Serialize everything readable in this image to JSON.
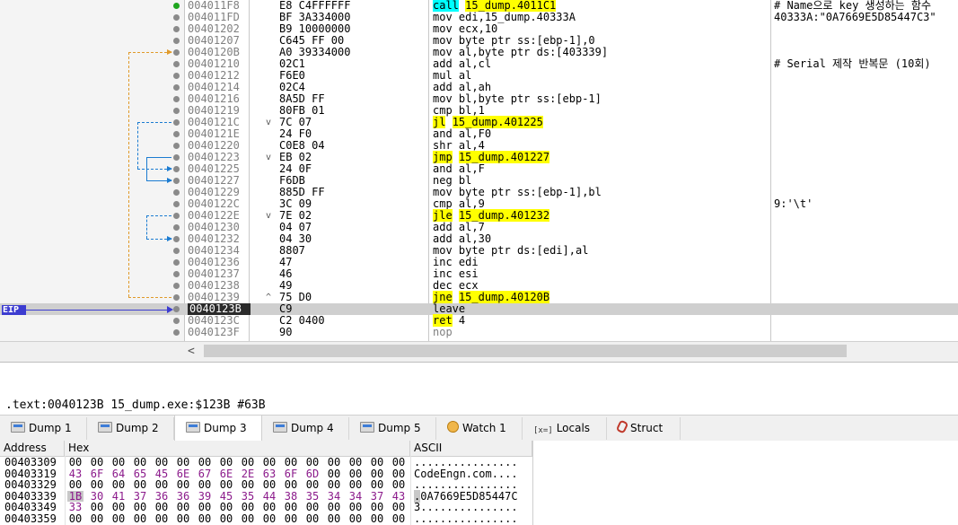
{
  "disassembly": {
    "rows": [
      {
        "addr": "004011F8",
        "bytes": "E8 C4FFFFFF",
        "mnem": "call",
        "ops": "15_dump.4011C1",
        "mnem_hl": "cyan",
        "ops_hl": "yellow",
        "jmark": "",
        "comment": "# Name으로 key 생성하는 함수",
        "dot": "green"
      },
      {
        "addr": "004011FD",
        "bytes": "BF 3A334000",
        "mnem": "mov",
        "ops": "edi,15_dump.40333A",
        "jmark": "",
        "comment": "40333A:\"0A7669E5D85447C3\""
      },
      {
        "addr": "00401202",
        "bytes": "B9 10000000",
        "mnem": "mov",
        "ops": "ecx,10",
        "jmark": "",
        "comment": ""
      },
      {
        "addr": "00401207",
        "bytes": "C645 FF 00",
        "mnem": "mov",
        "ops": "byte ptr ss:[ebp-1],0",
        "jmark": "",
        "comment": ""
      },
      {
        "addr": "0040120B",
        "bytes": "A0 39334000",
        "mnem": "mov",
        "ops": "al,byte ptr ds:[403339]",
        "jmark": "",
        "comment": ""
      },
      {
        "addr": "00401210",
        "bytes": "02C1",
        "mnem": "add",
        "ops": "al,cl",
        "jmark": "",
        "comment": "# Serial 제작 반복문 (10회)"
      },
      {
        "addr": "00401212",
        "bytes": "F6E0",
        "mnem": "mul",
        "ops": "al",
        "jmark": "",
        "comment": ""
      },
      {
        "addr": "00401214",
        "bytes": "02C4",
        "mnem": "add",
        "ops": "al,ah",
        "jmark": "",
        "comment": ""
      },
      {
        "addr": "00401216",
        "bytes": "8A5D FF",
        "mnem": "mov",
        "ops": "bl,byte ptr ss:[ebp-1]",
        "jmark": "",
        "comment": ""
      },
      {
        "addr": "00401219",
        "bytes": "80FB 01",
        "mnem": "cmp",
        "ops": "bl,1",
        "jmark": "",
        "comment": ""
      },
      {
        "addr": "0040121C",
        "bytes": "7C 07",
        "mnem": "jl",
        "ops": "15_dump.401225",
        "mnem_hl": "yellow",
        "ops_hl": "yellow",
        "jmark": "v",
        "comment": ""
      },
      {
        "addr": "0040121E",
        "bytes": "24 F0",
        "mnem": "and",
        "ops": "al,F0",
        "jmark": "",
        "comment": ""
      },
      {
        "addr": "00401220",
        "bytes": "C0E8 04",
        "mnem": "shr",
        "ops": "al,4",
        "jmark": "",
        "comment": ""
      },
      {
        "addr": "00401223",
        "bytes": "EB 02",
        "mnem": "jmp",
        "ops": "15_dump.401227",
        "mnem_hl": "yellow",
        "ops_hl": "yellow",
        "jmark": "v",
        "comment": ""
      },
      {
        "addr": "00401225",
        "bytes": "24 0F",
        "mnem": "and",
        "ops": "al,F",
        "jmark": "",
        "comment": ""
      },
      {
        "addr": "00401227",
        "bytes": "F6DB",
        "mnem": "neg",
        "ops": "bl",
        "jmark": "",
        "comment": ""
      },
      {
        "addr": "00401229",
        "bytes": "885D FF",
        "mnem": "mov",
        "ops": "byte ptr ss:[ebp-1],bl",
        "jmark": "",
        "comment": ""
      },
      {
        "addr": "0040122C",
        "bytes": "3C 09",
        "mnem": "cmp",
        "ops": "al,9",
        "jmark": "",
        "comment": "9:'\\t'"
      },
      {
        "addr": "0040122E",
        "bytes": "7E 02",
        "mnem": "jle",
        "ops": "15_dump.401232",
        "mnem_hl": "yellow",
        "ops_hl": "yellow",
        "jmark": "v",
        "comment": ""
      },
      {
        "addr": "00401230",
        "bytes": "04 07",
        "mnem": "add",
        "ops": "al,7",
        "jmark": "",
        "comment": ""
      },
      {
        "addr": "00401232",
        "bytes": "04 30",
        "mnem": "add",
        "ops": "al,30",
        "jmark": "",
        "comment": ""
      },
      {
        "addr": "00401234",
        "bytes": "8807",
        "mnem": "mov",
        "ops": "byte ptr ds:[edi],al",
        "jmark": "",
        "comment": ""
      },
      {
        "addr": "00401236",
        "bytes": "47",
        "mnem": "inc",
        "ops": "edi",
        "jmark": "",
        "comment": ""
      },
      {
        "addr": "00401237",
        "bytes": "46",
        "mnem": "inc",
        "ops": "esi",
        "jmark": "",
        "comment": ""
      },
      {
        "addr": "00401238",
        "bytes": "49",
        "mnem": "dec",
        "ops": "ecx",
        "jmark": "",
        "comment": ""
      },
      {
        "addr": "00401239",
        "bytes": "75 D0",
        "mnem": "jne",
        "ops": "15_dump.40120B",
        "mnem_hl": "yellow",
        "ops_hl": "yellow",
        "jmark": "^",
        "comment": ""
      },
      {
        "addr": "0040123B",
        "bytes": "C9",
        "mnem": "leave",
        "ops": "",
        "jmark": "",
        "comment": "",
        "current": true
      },
      {
        "addr": "0040123C",
        "bytes": "C2 0400",
        "mnem": "ret",
        "ops": "4",
        "mnem_hl": "yellow",
        "jmark": "",
        "comment": ""
      },
      {
        "addr": "0040123F",
        "bytes": "90",
        "mnem": "nop",
        "ops": "",
        "mnem_gray": true,
        "jmark": "",
        "comment": ""
      }
    ],
    "eip_label": "EIP"
  },
  "info_line": ".text:0040123B 15_dump.exe:$123B #63B",
  "tabs": [
    {
      "label": "Dump 1",
      "icon": "dump-icon"
    },
    {
      "label": "Dump 2",
      "icon": "dump-icon"
    },
    {
      "label": "Dump 3",
      "icon": "dump-icon",
      "active": true
    },
    {
      "label": "Dump 4",
      "icon": "dump-icon"
    },
    {
      "label": "Dump 5",
      "icon": "dump-icon"
    },
    {
      "label": "Watch 1",
      "icon": "watch-icon"
    },
    {
      "label": "Locals",
      "icon": "locals-icon",
      "icon_text": "[x=]"
    },
    {
      "label": "Struct",
      "icon": "struct-icon"
    }
  ],
  "dump": {
    "headers": {
      "address": "Address",
      "hex": "Hex",
      "ascii": "ASCII"
    },
    "rows": [
      {
        "addr": "00403309",
        "bytes": [
          "00",
          "00",
          "00",
          "00",
          "00",
          "00",
          "00",
          "00",
          "00",
          "00",
          "00",
          "00",
          "00",
          "00",
          "00",
          "00"
        ],
        "ascii": "................"
      },
      {
        "addr": "00403319",
        "bytes": [
          "43",
          "6F",
          "64",
          "65",
          "45",
          "6E",
          "67",
          "6E",
          "2E",
          "63",
          "6F",
          "6D",
          "00",
          "00",
          "00",
          "00"
        ],
        "ascii": "CodeEngn.com...."
      },
      {
        "addr": "00403329",
        "bytes": [
          "00",
          "00",
          "00",
          "00",
          "00",
          "00",
          "00",
          "00",
          "00",
          "00",
          "00",
          "00",
          "00",
          "00",
          "00",
          "00"
        ],
        "ascii": "................"
      },
      {
        "addr": "00403339",
        "bytes": [
          "1B",
          "30",
          "41",
          "37",
          "36",
          "36",
          "39",
          "45",
          "35",
          "44",
          "38",
          "35",
          "34",
          "34",
          "37",
          "43"
        ],
        "ascii": ".0A7669E5D85447C",
        "selected_byte": 0
      },
      {
        "addr": "00403349",
        "bytes": [
          "33",
          "00",
          "00",
          "00",
          "00",
          "00",
          "00",
          "00",
          "00",
          "00",
          "00",
          "00",
          "00",
          "00",
          "00",
          "00"
        ],
        "ascii": "3..............."
      },
      {
        "addr": "00403359",
        "bytes": [
          "00",
          "00",
          "00",
          "00",
          "00",
          "00",
          "00",
          "00",
          "00",
          "00",
          "00",
          "00",
          "00",
          "00",
          "00",
          "00"
        ],
        "ascii": "................"
      }
    ]
  }
}
